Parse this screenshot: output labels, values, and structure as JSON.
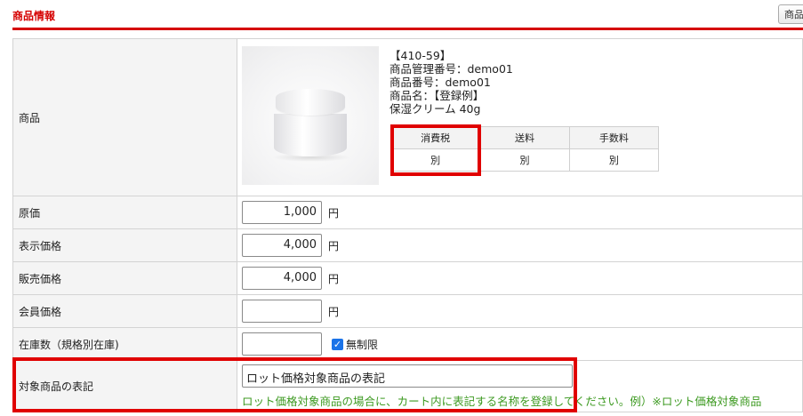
{
  "section": {
    "title": "商品情報",
    "top_button_label": "商品"
  },
  "product": {
    "label": "商品",
    "code": "【410-59】",
    "management_number": "商品管理番号：demo01",
    "product_number": "商品番号：demo01",
    "name_line1": "商品名：【登録例】",
    "name_line2": "保湿クリーム 40g",
    "tax_table": {
      "headers": [
        "消費税",
        "送料",
        "手数料"
      ],
      "values": [
        "別",
        "別",
        "別"
      ]
    }
  },
  "fields": {
    "cost_price": {
      "label": "原価",
      "value": "1,000",
      "unit": "円"
    },
    "display_price": {
      "label": "表示価格",
      "value": "4,000",
      "unit": "円"
    },
    "sale_price": {
      "label": "販売価格",
      "value": "4,000",
      "unit": "円"
    },
    "member_price": {
      "label": "会員価格",
      "value": "",
      "unit": "円"
    },
    "stock": {
      "label": "在庫数（規格別在庫)",
      "value": "",
      "unlimited_label": "無制限",
      "unlimited_checked": true
    },
    "target_label": {
      "label": "対象商品の表記",
      "value": "ロット価格対象商品の表記",
      "help": "ロット価格対象商品の場合に、カート内に表記する名称を登録してください。例）※ロット価格対象商品"
    }
  },
  "colors": {
    "accent": "#d50000",
    "highlight": "#e00000",
    "help_text": "#3d9a21",
    "checkbox": "#1a73e8"
  }
}
